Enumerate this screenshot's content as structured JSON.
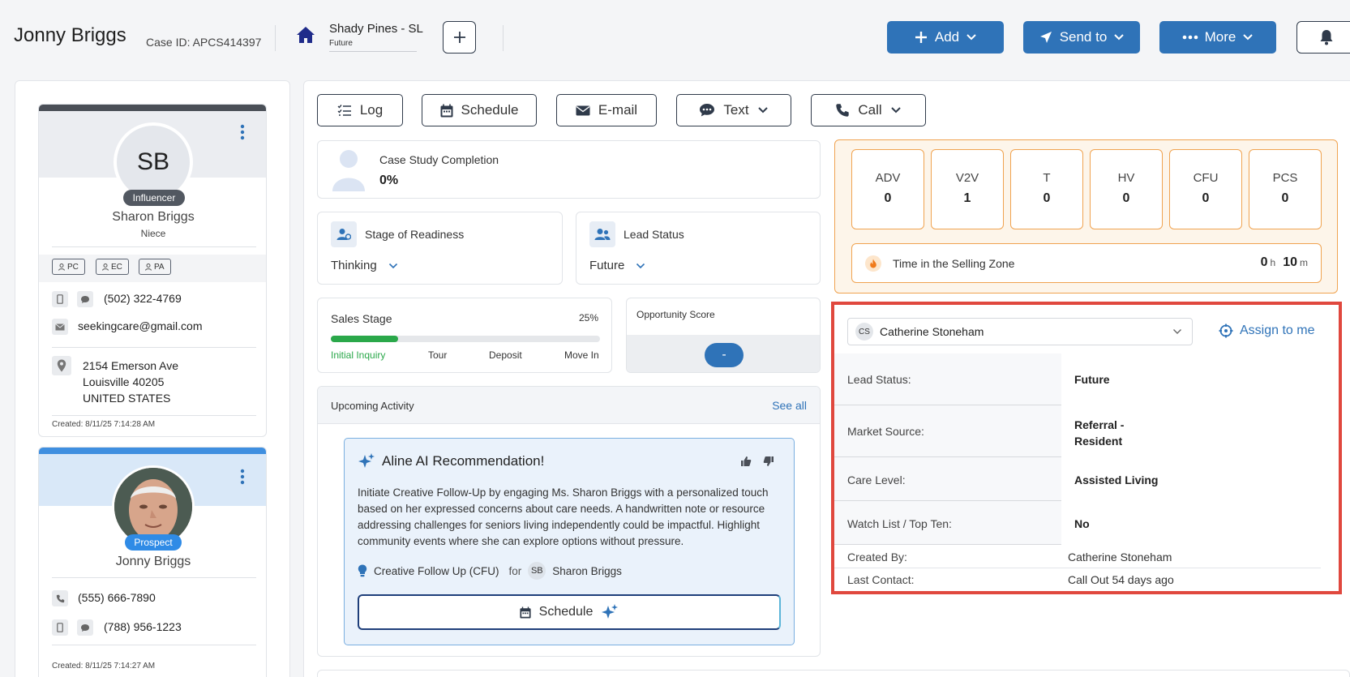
{
  "header": {
    "name": "Jonny Briggs",
    "case_id": "Case ID: APCS414397",
    "location_title": "Shady Pines - SL",
    "location_status": "Future",
    "add_label": "Add",
    "send_label": "Send to",
    "more_label": "More"
  },
  "contacts": [
    {
      "initials": "SB",
      "role": "Influencer",
      "name": "Sharon Briggs",
      "relation": "Niece",
      "chips": [
        "PC",
        "EC",
        "PA"
      ],
      "phone": "(502) 322-4769",
      "email": "seekingcare@gmail.com",
      "address": [
        "2154 Emerson Ave",
        "Louisville 40205",
        "UNITED STATES"
      ],
      "created": "Created: 8/11/25 7:14:28 AM"
    },
    {
      "role": "Prospect",
      "name": "Jonny Briggs",
      "phone1": "(555) 666-7890",
      "phone2": "(788) 956-1223",
      "created": "Created: 8/11/25 7:14:27 AM"
    }
  ],
  "actions": {
    "log": "Log",
    "schedule": "Schedule",
    "email": "E-mail",
    "text": "Text",
    "call": "Call"
  },
  "case_study": {
    "label": "Case Study Completion",
    "value": "0%"
  },
  "stage_of_readiness": {
    "label": "Stage of Readiness",
    "value": "Thinking"
  },
  "lead_status_card": {
    "label": "Lead Status",
    "value": "Future"
  },
  "sales_stage": {
    "label": "Sales Stage",
    "percent_text": "25%",
    "progress": 0.25,
    "steps": [
      "Initial Inquiry",
      "Tour",
      "Deposit",
      "Move In"
    ]
  },
  "opportunity": {
    "label": "Opportunity Score",
    "value": "-"
  },
  "upcoming": {
    "title": "Upcoming Activity",
    "see_all": "See all"
  },
  "ai": {
    "title": "Aline AI Recommendation!",
    "body": "Initiate Creative Follow-Up by engaging Ms. Sharon Briggs with a personalized touch based on her expressed concerns about care needs. A handwritten note or resource addressing challenges for seniors living independently could be impactful. Highlight community events where she can explore options without pressure.",
    "activity": "Creative Follow Up (CFU)",
    "for_word": "for",
    "for_initials": "SB",
    "for_name": "Sharon Briggs",
    "schedule": "Schedule"
  },
  "metrics": [
    {
      "label": "ADV",
      "value": "0"
    },
    {
      "label": "V2V",
      "value": "1"
    },
    {
      "label": "T",
      "value": "0"
    },
    {
      "label": "HV",
      "value": "0"
    },
    {
      "label": "CFU",
      "value": "0"
    },
    {
      "label": "PCS",
      "value": "0"
    }
  ],
  "selling_zone": {
    "label": "Time in the Selling Zone",
    "hours": "0",
    "h": "h",
    "minutes": "10",
    "m": "m"
  },
  "assign": {
    "initials": "CS",
    "name": "Catherine Stoneham",
    "assign_label": "Assign to me"
  },
  "details": [
    {
      "label": "Lead Status:",
      "value": "Future"
    },
    {
      "label": "Market Source:",
      "value": "Referral - Resident"
    },
    {
      "label": "Care Level:",
      "value": "Assisted Living"
    },
    {
      "label": "Watch List / Top Ten:",
      "value": "No"
    },
    {
      "label": "Created By:",
      "value": "Catherine Stoneham"
    },
    {
      "label": "Last Contact:",
      "value": "Call Out 54 days ago"
    }
  ],
  "colors": {
    "brand_blue": "#2f73b8",
    "highlight_red": "#e0483e",
    "metric_orange": "#f0a350",
    "progress_green": "#2aa84a"
  }
}
